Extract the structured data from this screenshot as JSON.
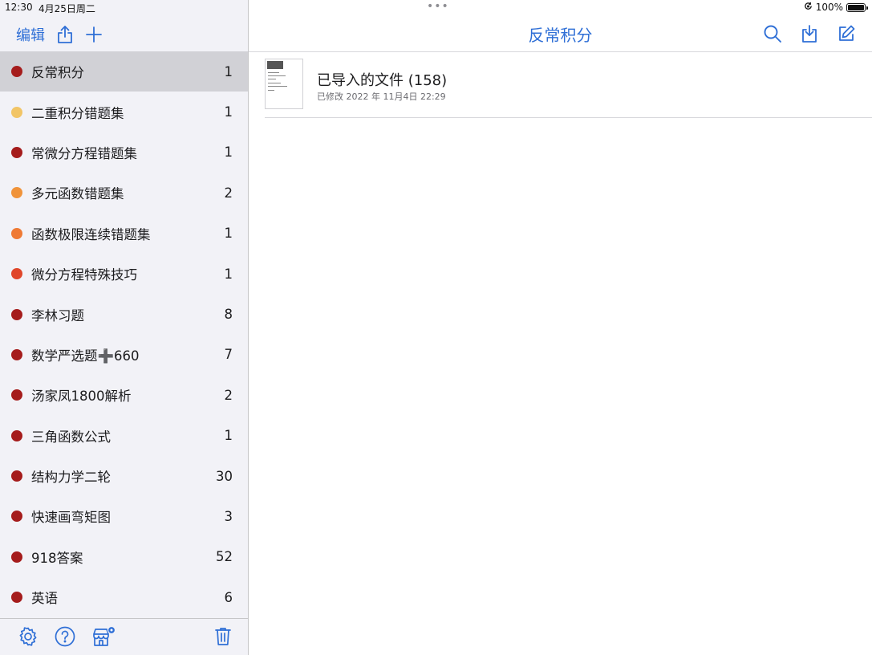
{
  "status_bar": {
    "time": "12:30",
    "date": "4月25日周二",
    "battery_pct": "100%"
  },
  "sidebar": {
    "edit_label": "编辑",
    "items": [
      {
        "label": "反常积分",
        "count": "1",
        "color": "#a51c1c",
        "selected": true
      },
      {
        "label": "二重积分错题集",
        "count": "1",
        "color": "#f2c566"
      },
      {
        "label": "常微分方程错题集",
        "count": "1",
        "color": "#a51c1c"
      },
      {
        "label": "多元函数错题集",
        "count": "2",
        "color": "#f0933a"
      },
      {
        "label": "函数极限连续错题集",
        "count": "1",
        "color": "#ef7a34"
      },
      {
        "label": "微分方程特殊技巧",
        "count": "1",
        "color": "#e0462a"
      },
      {
        "label": "李林习题",
        "count": "8",
        "color": "#a51c1c"
      },
      {
        "label": "数学严选题➕660",
        "count": "7",
        "color": "#a51c1c"
      },
      {
        "label": "汤家凤1800解析",
        "count": "2",
        "color": "#a51c1c"
      },
      {
        "label": "三角函数公式",
        "count": "1",
        "color": "#a51c1c"
      },
      {
        "label": "结构力学二轮",
        "count": "30",
        "color": "#a51c1c"
      },
      {
        "label": "快速画弯矩图",
        "count": "3",
        "color": "#a51c1c"
      },
      {
        "label": "918答案",
        "count": "52",
        "color": "#a51c1c"
      },
      {
        "label": "英语",
        "count": "6",
        "color": "#a51c1c"
      }
    ]
  },
  "main": {
    "title": "反常积分",
    "documents": [
      {
        "title": "已导入的文件 (158)",
        "subtitle": "已修改 2022 年 11月4日 22:29"
      }
    ]
  },
  "colors": {
    "accent": "#2f6fd6",
    "selected_row": "#d1d1d6"
  }
}
